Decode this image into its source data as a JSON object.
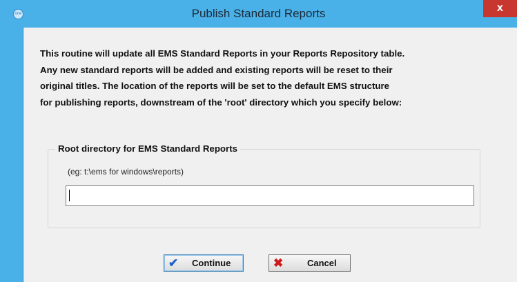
{
  "window": {
    "title": "Publish Standard Reports",
    "app_icon_text": "one",
    "close_label": "x"
  },
  "description": "This routine will update all EMS Standard Reports in your Reports Repository table.\nAny new standard reports will be added and existing reports will be reset to their\noriginal titles. The location of the reports will be set to the default EMS structure\nfor publishing reports, downstream of the 'root' directory which you specify below:",
  "group": {
    "legend": "Root directory for EMS Standard Reports",
    "example": "(eg: t:\\ems for windows\\reports)",
    "input_value": ""
  },
  "buttons": {
    "continue_label": "Continue",
    "cancel_label": "Cancel"
  },
  "icons": {
    "continue": "check-icon",
    "cancel": "cross-icon"
  },
  "colors": {
    "titlebar": "#4ab0e8",
    "close": "#c7372f",
    "check": "#1d5fc7",
    "cross": "#d01818"
  }
}
